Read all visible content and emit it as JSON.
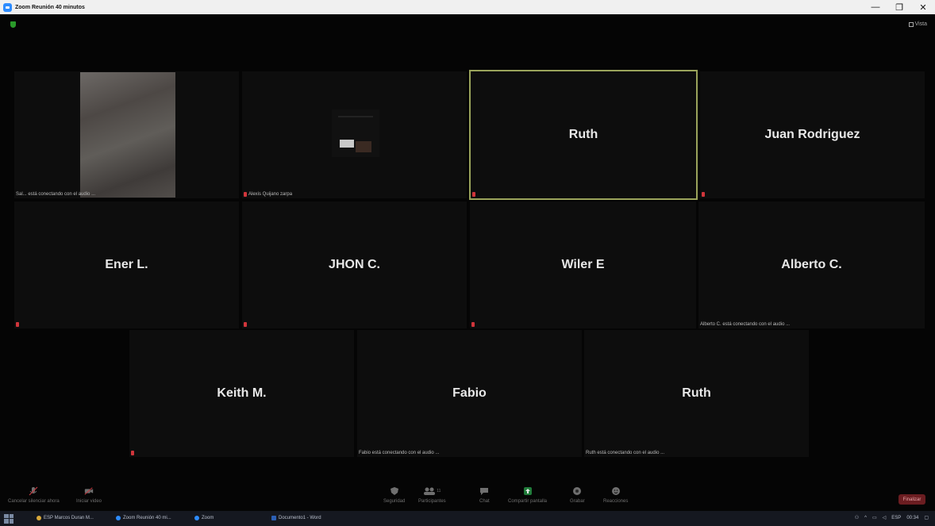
{
  "window": {
    "title": "Zoom Reunión 40 minutos",
    "minimize_glyph": "—",
    "restore_glyph": "❐",
    "close_glyph": "✕"
  },
  "meeting": {
    "view_label": "Vista",
    "tiles": [
      {
        "name": "",
        "caption": "Sal... está conectando con el audio ..."
      },
      {
        "name": "",
        "caption": "Alexis Quijano zarpa"
      },
      {
        "name": "Ruth",
        "caption": ""
      },
      {
        "name": "Juan Rodriguez",
        "caption": ""
      },
      {
        "name": "Ener L.",
        "caption": ""
      },
      {
        "name": "JHON C.",
        "caption": ""
      },
      {
        "name": "Wiler E",
        "caption": ""
      },
      {
        "name": "Alberto C.",
        "caption": "Alberto C. está conectando con el audio ..."
      },
      {
        "name": "Keith M.",
        "caption": ""
      },
      {
        "name": "Fabio",
        "caption": "Fabio está conectando con el audio ..."
      },
      {
        "name": "Ruth",
        "caption": "Ruth está conectando con el audio ..."
      }
    ]
  },
  "toolbar": {
    "audio": "Cancelar silenciar ahora",
    "video": "Iniciar video",
    "security": "Seguridad",
    "participants": "Participantes",
    "participants_count": "11",
    "chat": "Chat",
    "share": "Compartir pantalla",
    "record": "Grabar",
    "reactions": "Reacciones",
    "end": "Finalizar"
  },
  "taskbar": {
    "apps": [
      "ESP Marcos Duran M...",
      "Zoom Reunión 40 mi...",
      "Zoom",
      "Documento1 - Word"
    ],
    "tray": {
      "lang": "ESP",
      "time": "00:34"
    }
  },
  "colors": {
    "active_border": "#9aa35b",
    "mute": "#d0353b",
    "end_button": "#6b1d21",
    "zoom_blue": "#2d8cff"
  }
}
